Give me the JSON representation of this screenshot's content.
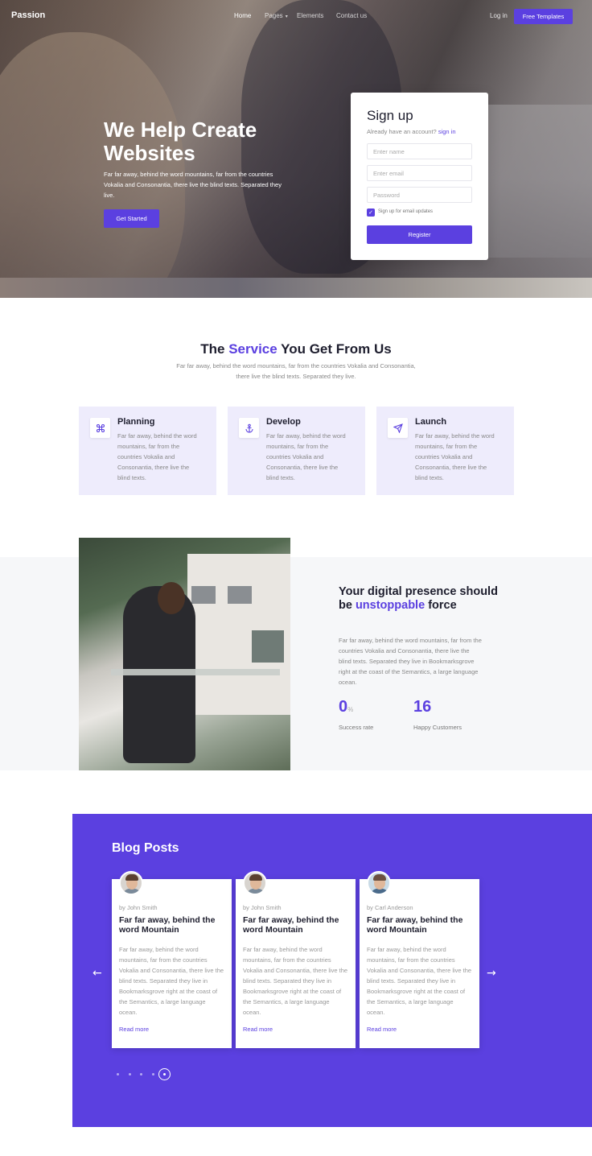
{
  "header": {
    "brand": "Passion",
    "nav": [
      {
        "label": "Home"
      },
      {
        "label": "Pages",
        "dropdown": true
      },
      {
        "label": "Elements"
      },
      {
        "label": "Contact us"
      }
    ],
    "login": "Log in",
    "cta": "Free Templates"
  },
  "hero": {
    "title": "We Help Create Websites",
    "text": "Far far away, behind the word mountains, far from the countries Vokalia and Consonantia, there live the blind texts. Separated they live.",
    "button": "Get Started"
  },
  "signup": {
    "title": "Sign up",
    "have_account": "Already have an account?",
    "sign_in": "sign in",
    "name_placeholder": "Enter name",
    "email_placeholder": "Enter email",
    "password_placeholder": "Password",
    "checkbox_label": "Sign up for email updates",
    "checkbox_checked": true,
    "register": "Register"
  },
  "services": {
    "title_pre": "The",
    "title_hl": "Service",
    "title_post": "You Get From Us",
    "subtitle": "Far far away, behind the word mountains, far from the countries Vokalia and Consonantia, there live the blind texts. Separated they live.",
    "items": [
      {
        "icon": "command-icon",
        "title": "Planning",
        "text": "Far far away, behind the word mountains, far from the countries Vokalia and Consonantia, there live the blind texts."
      },
      {
        "icon": "anchor-icon",
        "title": "Develop",
        "text": "Far far away, behind the word mountains, far from the countries Vokalia and Consonantia, there live the blind texts."
      },
      {
        "icon": "send-icon",
        "title": "Launch",
        "text": "Far far away, behind the word mountains, far from the countries Vokalia and Consonantia, there live the blind texts."
      }
    ]
  },
  "presence": {
    "title_pre": "Your digital presence should be",
    "title_hl": "unstoppable",
    "title_post": "force",
    "text": "Far far away, behind the word mountains, far from the countries Vokalia and Consonantia, there live the blind texts. Separated they live in Bookmarksgrove right at the coast of the Semantics, a large language ocean.",
    "stats": [
      {
        "value": "0",
        "suffix": "%",
        "label": "Success rate"
      },
      {
        "value": "16",
        "suffix": "",
        "label": "Happy Customers"
      }
    ]
  },
  "blog": {
    "title": "Blog Posts",
    "posts": [
      {
        "author": "by John Smith",
        "title": "Far far away, behind the word Mountain",
        "text": "Far far away, behind the word mountains, far from the countries Vokalia and Consonantia, there live the blind texts. Separated they live in Bookmarksgrove right at the coast of the Semantics, a large language ocean.",
        "link": "Read more"
      },
      {
        "author": "by John Smith",
        "title": "Far far away, behind the word Mountain",
        "text": "Far far away, behind the word mountains, far from the countries Vokalia and Consonantia, there live the blind texts. Separated they live in Bookmarksgrove right at the coast of the Semantics, a large language ocean.",
        "link": "Read more"
      },
      {
        "author": "by Carl Anderson",
        "title": "Far far away, behind the word Mountain",
        "text": "Far far away, behind the word mountains, far from the countries Vokalia and Consonantia, there live the blind texts. Separated they live in Bookmarksgrove right at the coast of the Semantics, a large language ocean.",
        "link": "Read more"
      }
    ],
    "prev_icon": "arrow-left-icon",
    "next_icon": "arrow-right-icon",
    "dots": 5,
    "active_dot": 5
  },
  "colors": {
    "accent": "#5b40e0",
    "card_bg": "#eeecfc",
    "section_bg": "#f6f7f9"
  }
}
